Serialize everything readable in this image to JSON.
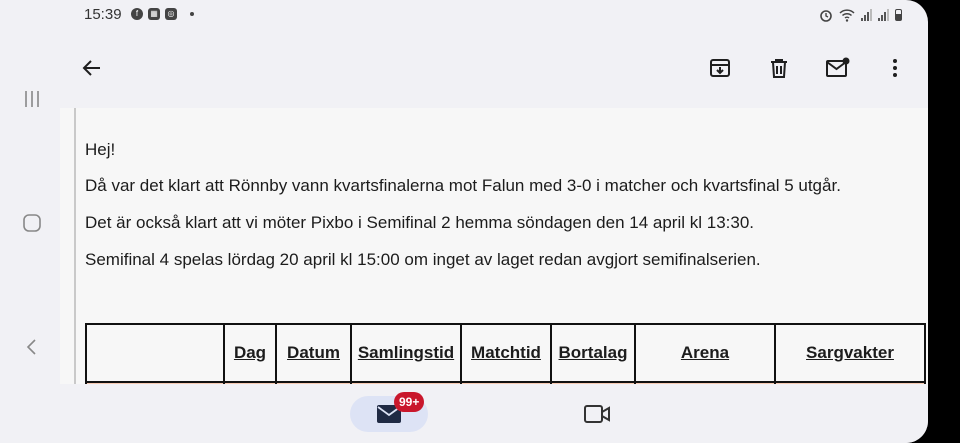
{
  "status_bar": {
    "time": "15:39",
    "app_icons": [
      "facebook-icon",
      "news-icon",
      "instagram-icon"
    ]
  },
  "toolbar": {
    "back_icon": "arrow-left-icon",
    "actions": [
      "archive-icon",
      "trash-icon",
      "mark-unread-icon",
      "more-vert-icon"
    ]
  },
  "email": {
    "greeting": "Hej!",
    "paragraph1": "Då var det klart att Rönnby vann kvartsfinalerna mot Falun med 3-0 i matcher och kvartsfinal 5 utgår.",
    "paragraph2": "Det är också klart att vi möter Pixbo i Semifinal 2 hemma söndagen den 14 april kl 13:30.",
    "paragraph3": "Semifinal 4 spelas lördag 20 april kl 15:00 om inget av laget redan avgjort semifinalserien."
  },
  "table": {
    "headers": [
      "",
      "Dag",
      "Datum",
      "Samlingstid",
      "Matchtid",
      "Bortalag",
      "Arena",
      "Sargvakter"
    ]
  },
  "bottom_nav": {
    "mail_badge": "99+"
  },
  "colors": {
    "table_accent": "#f6c9b2",
    "badge": "#c9172c",
    "active_pill": "#dde3f5"
  }
}
